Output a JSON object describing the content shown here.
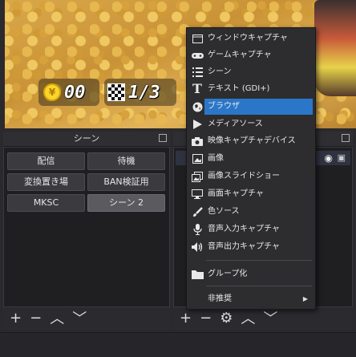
{
  "hud": {
    "coin_count": "00",
    "lap_count": "1/3"
  },
  "scene_dock": {
    "title": "シーン",
    "scenes": [
      "配信",
      "待機",
      "変換置き場",
      "BAN検証用",
      "MKSC",
      "シーン 2"
    ],
    "selected_index": 5,
    "toolbar": {
      "add": "+",
      "remove": "−",
      "up": "︿",
      "down": "﹀"
    }
  },
  "source_dock": {
    "toolbar": {
      "add": "+",
      "remove": "−",
      "settings": "⚙",
      "up": "︿",
      "down": "﹀"
    }
  },
  "context_menu": {
    "items": [
      {
        "label": "ウィンドウキャプチャ",
        "icon": "window-icon"
      },
      {
        "label": "ゲームキャプチャ",
        "icon": "gamepad-icon"
      },
      {
        "label": "シーン",
        "icon": "list-icon"
      },
      {
        "label": "テキスト (GDI+)",
        "icon": "text-icon"
      },
      {
        "label": "ブラウザ",
        "icon": "globe-icon"
      },
      {
        "label": "メディアソース",
        "icon": "play-icon"
      },
      {
        "label": "映像キャプチャデバイス",
        "icon": "camera-icon"
      },
      {
        "label": "画像",
        "icon": "image-icon"
      },
      {
        "label": "画像スライドショー",
        "icon": "slideshow-icon"
      },
      {
        "label": "画面キャプチャ",
        "icon": "monitor-icon"
      },
      {
        "label": "色ソース",
        "icon": "brush-icon"
      },
      {
        "label": "音声入力キャプチャ",
        "icon": "microphone-icon"
      },
      {
        "label": "音声出力キャプチャ",
        "icon": "speaker-icon"
      },
      {
        "label": "グループ化",
        "icon": "folder-icon"
      },
      {
        "label": "非推奨",
        "icon": ""
      }
    ],
    "highlighted": "ブラウザ",
    "highlight_color": "#2a77c9"
  }
}
